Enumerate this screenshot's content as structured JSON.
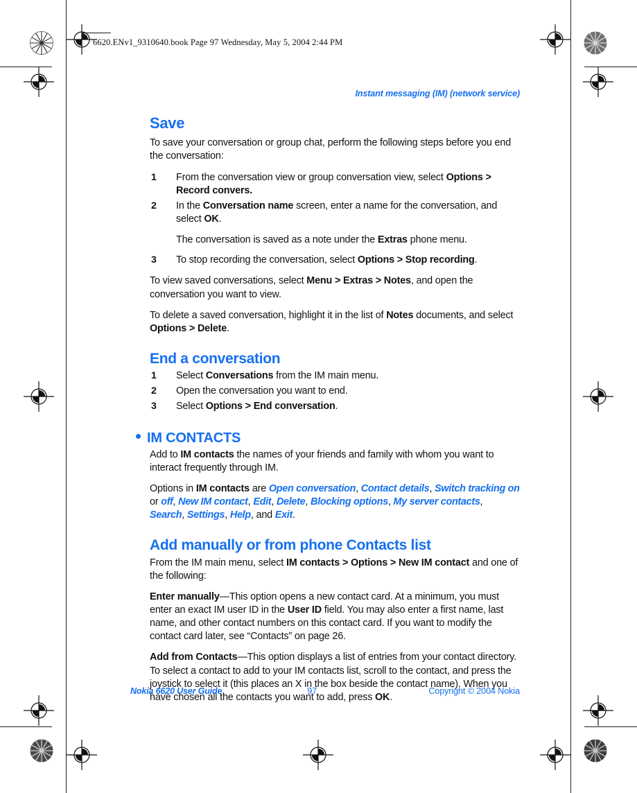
{
  "print_marks": {
    "book_header_line": "6620.ENv1_9310640.book  Page 97  Wednesday, May 5, 2004  2:44 PM",
    "registration_mark_name": "registration-target",
    "density_patch_name": "density-star-patch"
  },
  "colors": {
    "accent_blue": "#1570ef",
    "body_text": "#111111",
    "trim_line": "#1a1a1a"
  },
  "running_head": "Instant messaging (IM) (network service)",
  "sections": {
    "save": {
      "heading": "Save",
      "intro": "To save your conversation or group chat, perform the following steps before you end the conversation:",
      "steps": [
        {
          "num": "1",
          "parts": [
            {
              "t": "From the conversation view or group conversation view, select ",
              "s": "normal"
            },
            {
              "t": "Options > Record convers.",
              "s": "bold"
            }
          ]
        },
        {
          "num": "2",
          "parts": [
            {
              "t": "In the ",
              "s": "normal"
            },
            {
              "t": "Conversation name",
              "s": "bold"
            },
            {
              "t": " screen, enter a name for the conversation, and select ",
              "s": "normal"
            },
            {
              "t": "OK",
              "s": "bold"
            },
            {
              "t": ".",
              "s": "normal"
            }
          ]
        }
      ],
      "substep": [
        {
          "t": "The conversation is saved as a note under the ",
          "s": "normal"
        },
        {
          "t": "Extras",
          "s": "bold"
        },
        {
          "t": " phone menu.",
          "s": "normal"
        }
      ],
      "step3": {
        "num": "3",
        "parts": [
          {
            "t": "To stop recording the conversation, select ",
            "s": "normal"
          },
          {
            "t": "Options > Stop recording",
            "s": "bold"
          },
          {
            "t": ".",
            "s": "normal"
          }
        ]
      },
      "para_view": [
        {
          "t": "To view saved conversations, select ",
          "s": "normal"
        },
        {
          "t": "Menu > Extras > Notes",
          "s": "bold"
        },
        {
          "t": ", and open the conversation you want to view.",
          "s": "normal"
        }
      ],
      "para_delete": [
        {
          "t": "To delete a saved conversation, highlight it in the list of ",
          "s": "normal"
        },
        {
          "t": "Notes",
          "s": "bold"
        },
        {
          "t": " documents, and select ",
          "s": "normal"
        },
        {
          "t": "Options > Delete",
          "s": "bold"
        },
        {
          "t": ".",
          "s": "normal"
        }
      ]
    },
    "end_conversation": {
      "heading": "End a conversation",
      "steps": [
        {
          "num": "1",
          "parts": [
            {
              "t": "Select ",
              "s": "normal"
            },
            {
              "t": "Conversations",
              "s": "bold"
            },
            {
              "t": " from the IM main menu.",
              "s": "normal"
            }
          ]
        },
        {
          "num": "2",
          "parts": [
            {
              "t": "Open the conversation you want to end.",
              "s": "normal"
            }
          ]
        },
        {
          "num": "3",
          "parts": [
            {
              "t": "Select ",
              "s": "normal"
            },
            {
              "t": "Options > End conversation",
              "s": "bold"
            },
            {
              "t": ".",
              "s": "normal"
            }
          ]
        }
      ]
    },
    "im_contacts": {
      "heading": "IM CONTACTS",
      "para_add": [
        {
          "t": "Add to ",
          "s": "normal"
        },
        {
          "t": "IM contacts",
          "s": "bold"
        },
        {
          "t": " the names of your friends and family with whom you want to interact frequently through IM.",
          "s": "normal"
        }
      ],
      "para_options": [
        {
          "t": "Options in ",
          "s": "normal"
        },
        {
          "t": "IM contacts",
          "s": "bold"
        },
        {
          "t": " are ",
          "s": "normal"
        },
        {
          "t": "Open conversation",
          "s": "option"
        },
        {
          "t": ", ",
          "s": "normal"
        },
        {
          "t": "Contact details",
          "s": "option"
        },
        {
          "t": ", ",
          "s": "normal"
        },
        {
          "t": "Switch tracking on",
          "s": "option"
        },
        {
          "t": " or ",
          "s": "normal"
        },
        {
          "t": "off",
          "s": "option"
        },
        {
          "t": ", ",
          "s": "normal"
        },
        {
          "t": "New IM contact",
          "s": "option"
        },
        {
          "t": ", ",
          "s": "normal"
        },
        {
          "t": "Edit",
          "s": "option"
        },
        {
          "t": ", ",
          "s": "normal"
        },
        {
          "t": "Delete",
          "s": "option"
        },
        {
          "t": ", ",
          "s": "normal"
        },
        {
          "t": "Blocking options",
          "s": "option"
        },
        {
          "t": ", ",
          "s": "normal"
        },
        {
          "t": "My server contacts",
          "s": "option"
        },
        {
          "t": ", ",
          "s": "normal"
        },
        {
          "t": "Search",
          "s": "option"
        },
        {
          "t": ", ",
          "s": "normal"
        },
        {
          "t": "Settings",
          "s": "option"
        },
        {
          "t": ", ",
          "s": "normal"
        },
        {
          "t": "Help",
          "s": "option"
        },
        {
          "t": ", and ",
          "s": "normal"
        },
        {
          "t": "Exit",
          "s": "option"
        },
        {
          "t": ".",
          "s": "normal"
        }
      ]
    },
    "add_manually": {
      "heading": "Add manually or from phone Contacts list",
      "para_from": [
        {
          "t": "From the IM main menu, select ",
          "s": "normal"
        },
        {
          "t": "IM contacts > Options > New IM contact",
          "s": "bold"
        },
        {
          "t": " and one of the following:",
          "s": "normal"
        }
      ],
      "para_enter_manually": [
        {
          "t": "Enter manually",
          "s": "bold"
        },
        {
          "t": "—This option opens a new contact card. At a minimum, you must enter an exact IM user ID in the ",
          "s": "normal"
        },
        {
          "t": "User ID",
          "s": "bold"
        },
        {
          "t": " field. You may also enter a first name, last name, and other contact numbers on this contact card. If you want to modify the contact card later, see “Contacts” on page 26.",
          "s": "normal"
        }
      ],
      "para_add_from_contacts": [
        {
          "t": "Add from Contacts",
          "s": "bold"
        },
        {
          "t": "—This option displays a list of entries from your contact directory. To select a contact to add to your IM contacts list, scroll to the contact, and press the joystick to select it (this places an X in the box beside the contact name). When you have chosen all the contacts you want to add, press ",
          "s": "normal"
        },
        {
          "t": "OK",
          "s": "bold"
        },
        {
          "t": ".",
          "s": "normal"
        }
      ]
    }
  },
  "footer": {
    "left": "Nokia 6620 User Guide",
    "page_number": "97",
    "right": "Copyright © 2004 Nokia"
  }
}
